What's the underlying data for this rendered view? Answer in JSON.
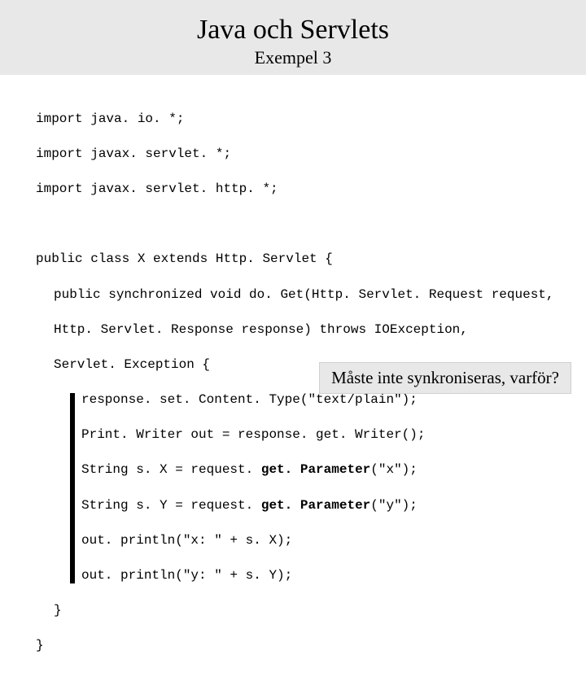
{
  "header": {
    "title": "Java och Servlets",
    "subtitle": "Exempel 3"
  },
  "code": {
    "imp1": "import java. io. *;",
    "imp2": "import javax. servlet. *;",
    "imp3": "import javax. servlet. http. *;",
    "cls": "public class X extends Http. Servlet {",
    "m1": "public synchronized void do. Get(Http. Servlet. Request request,",
    "m2": "Http. Servlet. Response response) throws IOException,",
    "m3": "Servlet. Exception {",
    "b1": "response. set. Content. Type(\"text/plain\");",
    "b2": "Print. Writer out = response. get. Writer();",
    "b3a": "String s. X = request. ",
    "b3b": "get. Parameter",
    "b3c": "(\"x\");",
    "b4a": "String s. Y = request. ",
    "b4b": "get. Parameter",
    "b4c": "(\"y\");",
    "b5": "out. println(\"x: \" + s. X);",
    "b6": "out. println(\"y: \" + s. Y);",
    "close1": "}",
    "close2": "}"
  },
  "callout": {
    "text": "Måste inte synkroniseras, varför?"
  }
}
